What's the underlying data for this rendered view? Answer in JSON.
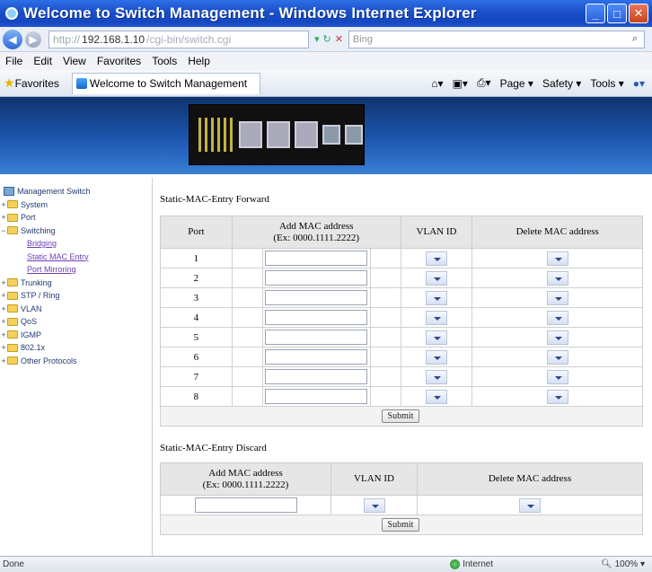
{
  "window": {
    "title": "Welcome to Switch Management - Windows Internet Explorer",
    "address_protocol": "http://",
    "address_host": "192.168.1.10",
    "address_path": "/cgi-bin/switch.cgi",
    "search_placeholder": "Bing",
    "tab_title": "Welcome to Switch Management",
    "favorites_label": "Favorites",
    "menu": [
      "File",
      "Edit",
      "View",
      "Favorites",
      "Tools",
      "Help"
    ],
    "commands": [
      "Page ▾",
      "Safety ▾",
      "Tools ▾"
    ],
    "status_left": "Done",
    "status_zone": "Internet",
    "status_zoom": "100%"
  },
  "sidebar": {
    "root": "Management Switch",
    "nodes": [
      {
        "label": "System",
        "expanded": false
      },
      {
        "label": "Port",
        "expanded": false
      },
      {
        "label": "Switching",
        "expanded": true,
        "children": [
          "Bridging",
          "Static MAC Entry",
          "Port Mirroring"
        ]
      },
      {
        "label": "Trunking",
        "expanded": false
      },
      {
        "label": "STP / Ring",
        "expanded": false
      },
      {
        "label": "VLAN",
        "expanded": false
      },
      {
        "label": "QoS",
        "expanded": false
      },
      {
        "label": "IGMP",
        "expanded": false
      },
      {
        "label": "802.1x",
        "expanded": false
      },
      {
        "label": "Other Protocols",
        "expanded": false
      }
    ]
  },
  "forward": {
    "title": "Static-MAC-Entry Forward",
    "headers": {
      "port": "Port",
      "mac_line1": "Add MAC address",
      "mac_line2": "(Ex: 0000.1111.2222)",
      "vlan": "VLAN ID",
      "delete": "Delete MAC address"
    },
    "ports": [
      "1",
      "2",
      "3",
      "4",
      "5",
      "6",
      "7",
      "8"
    ],
    "submit": "Submit"
  },
  "discard": {
    "title": "Static-MAC-Entry Discard",
    "headers": {
      "mac_line1": "Add MAC address",
      "mac_line2": "(Ex: 0000.1111.2222)",
      "vlan": "VLAN ID",
      "delete": "Delete MAC address"
    },
    "submit": "Submit"
  }
}
